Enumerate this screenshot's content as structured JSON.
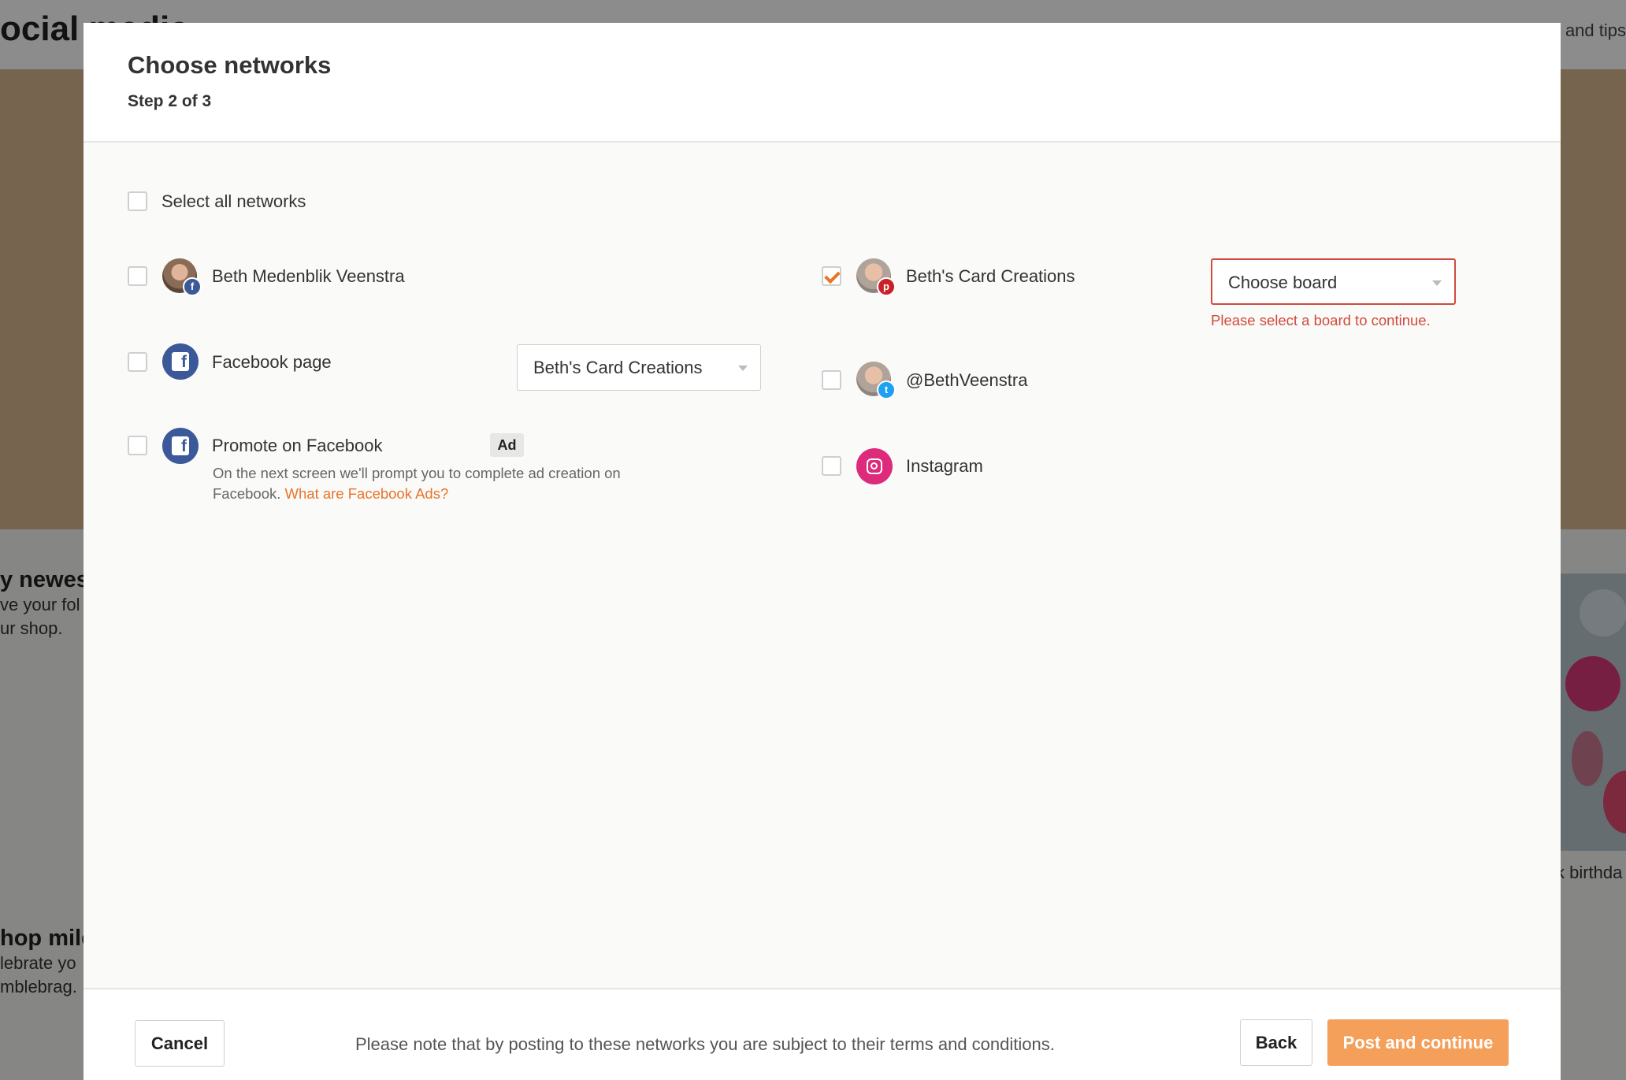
{
  "background": {
    "page_title": "ocial media",
    "tips_link": "s and tips",
    "card1": {
      "title": "y newest",
      "lines": [
        "ve your fol",
        "ur shop."
      ]
    },
    "card2": {
      "title": "hop mile",
      "lines": [
        "lebrate yo",
        "mblebrag."
      ]
    },
    "image_caption": "k birthda"
  },
  "modal": {
    "title": "Choose networks",
    "step": "Step 2 of 3",
    "select_all_label": "Select all networks",
    "networks": {
      "fb_profile": {
        "label": "Beth Medenblik Veenstra",
        "checked": false,
        "badge": "f"
      },
      "fb_page": {
        "label": "Facebook page",
        "checked": false,
        "select_value": "Beth's Card Creations"
      },
      "fb_promote": {
        "label": "Promote on Facebook",
        "checked": false,
        "badge": "Ad",
        "note": "On the next screen we'll prompt you to complete ad creation on Facebook.",
        "note_link": "What are Facebook Ads?"
      },
      "pinterest": {
        "label": "Beth's Card Creations",
        "checked": true,
        "badge": "p",
        "select_value": "Choose board",
        "error": "Please select a board to continue."
      },
      "twitter": {
        "label": "@BethVeenstra",
        "checked": false,
        "badge": "t"
      },
      "instagram": {
        "label": "Instagram",
        "checked": false
      }
    },
    "footer": {
      "cancel_label": "Cancel",
      "note": "Please note that by posting to these networks you are subject to their terms and conditions.",
      "back_label": "Back",
      "post_label": "Post and continue"
    }
  },
  "colors": {
    "accent": "#e8742b",
    "primary_button": "#f5a05a",
    "error": "#d04a3d",
    "facebook": "#3b5998",
    "pinterest": "#cb2027",
    "twitter": "#1da1f2",
    "instagram": "#dd2a7b"
  }
}
